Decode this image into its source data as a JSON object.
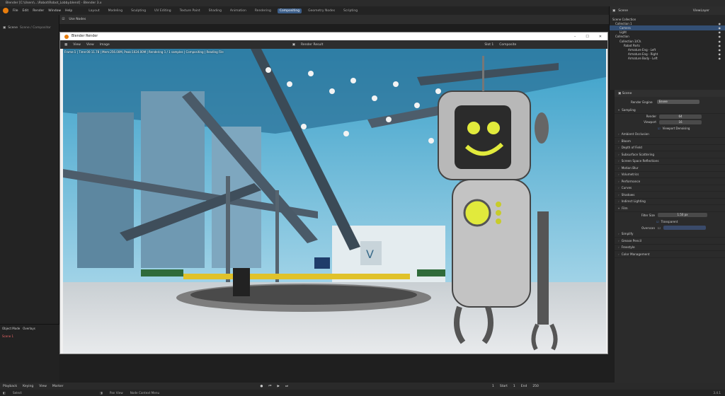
{
  "titlebar": {
    "text": "Blender [C:\\Users\\...\\Robot\\Robot_Lobby.blend] - Blender 3.x"
  },
  "menubar": {
    "menus": [
      "File",
      "Edit",
      "Render",
      "Window",
      "Help"
    ],
    "workspaces": [
      "Layout",
      "Modeling",
      "Sculpting",
      "UV Editing",
      "Texture Paint",
      "Shading",
      "Animation",
      "Rendering",
      "Compositing",
      "Geometry Nodes",
      "Scripting"
    ],
    "active_workspace": "Compositing"
  },
  "left_header": {
    "items": [
      "View",
      "Select",
      "Add",
      "Node",
      "Use Nodes"
    ],
    "selected": "Add"
  },
  "scene_row": {
    "label": "Scene",
    "sub": "Scene / Compositor"
  },
  "outliner": {
    "search_placeholder": "Scene",
    "view_layer": "ViewLayer",
    "rows": [
      {
        "label": "Scene Collection",
        "selected": false
      },
      {
        "label": "Collection 1",
        "selected": false
      },
      {
        "label": "Camera",
        "selected": true
      },
      {
        "label": "Light",
        "selected": false
      },
      {
        "label": "Collection",
        "selected": false
      },
      {
        "label": "Collection 3/Ch.",
        "selected": false
      },
      {
        "label": "Robot Parts",
        "selected": false
      },
      {
        "label": "Armature Eng - Left",
        "selected": false
      },
      {
        "label": "Armature Eng - Right",
        "selected": false
      },
      {
        "label": "Armature Body - Left",
        "selected": false
      }
    ]
  },
  "properties": {
    "title": "Scene",
    "render_engine_label": "Render Engine",
    "render_engine": "Eevee",
    "sampling_label": "Sampling",
    "render_label": "Render",
    "render_value": "64",
    "viewport_label": "Viewport",
    "viewport_value": "16",
    "viewport_denoising": "Viewport Denoising",
    "panels": [
      "Ambient Occlusion",
      "Bloom",
      "Depth of Field",
      "Subsurface Scattering",
      "Screen Space Reflections",
      "Motion Blur",
      "Volumetrics",
      "Performance",
      "Curves",
      "Shadows",
      "Indirect Lighting",
      "Film"
    ],
    "filter_size_label": "Filter Size",
    "filter_size": "1.50 px",
    "transparent": "Transparent",
    "overscan_label": "Overscan",
    "panels_after": [
      "Simplify",
      "Grease Pencil",
      "Freestyle",
      "Color Management"
    ]
  },
  "render_window": {
    "title": "Blender Render",
    "header_items": [
      "View",
      "View",
      "Image"
    ],
    "render_result": "Render Result",
    "slot": "Slot 1",
    "composite": "Composite",
    "status": "Frame:1 | Time:00:11.78 | Mem:256.00M, Peak:1024.00M | Rendering 1 / 1 samples | Compositing | Reading File"
  },
  "left_lower": {
    "items": [
      "Object Mode",
      "Overlays",
      "Scene 1"
    ]
  },
  "timeline": {
    "items": [
      "Playback",
      "Keying",
      "View",
      "Marker"
    ],
    "start": "Start",
    "start_val": "1",
    "end": "End",
    "end_val": "250",
    "frame": "1"
  },
  "statusbar": {
    "left": "Select",
    "mid": "Pan View",
    "right": "Node Context Menu",
    "version": "3.4.1"
  },
  "colors": {
    "accent": "#4772b3",
    "selected": "#334f74",
    "orange": "#e87d0d"
  }
}
